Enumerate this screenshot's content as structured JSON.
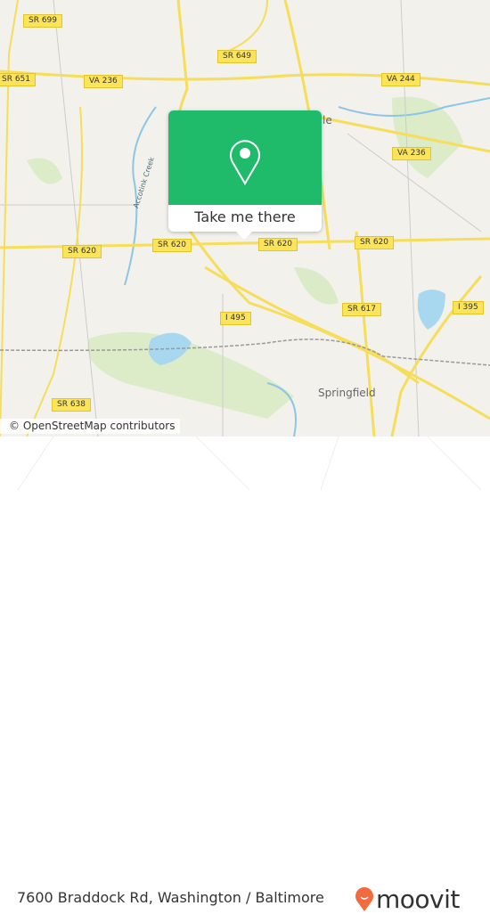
{
  "map": {
    "shields": [
      {
        "label": "SR 699"
      },
      {
        "label": "SR 651"
      },
      {
        "label": "VA 236"
      },
      {
        "label": "SR 649"
      },
      {
        "label": "VA 244"
      },
      {
        "label": "VA 236"
      },
      {
        "label": "SR 620"
      },
      {
        "label": "SR 620"
      },
      {
        "label": "SR 620"
      },
      {
        "label": "SR 620"
      },
      {
        "label": "I 495"
      },
      {
        "label": "SR 617"
      },
      {
        "label": "I 395"
      },
      {
        "label": "SR 638"
      }
    ],
    "places": {
      "springfield": "Springfield",
      "annandale_partial": "le",
      "creek": "Accotink Creek"
    },
    "colors": {
      "land": "#f2f1ec",
      "road": "#f6dd5a",
      "water": "#a8d8f0",
      "park": "#d9ebc4",
      "accent": "#1fba6a"
    }
  },
  "attribution": "© OpenStreetMap contributors",
  "popup": {
    "icon": "location-pin-icon",
    "button_label": "Take me there"
  },
  "footer": {
    "address": "7600 Braddock Rd, Washington / Baltimore",
    "brand": "moovit",
    "brand_color": "#f26a3d"
  }
}
